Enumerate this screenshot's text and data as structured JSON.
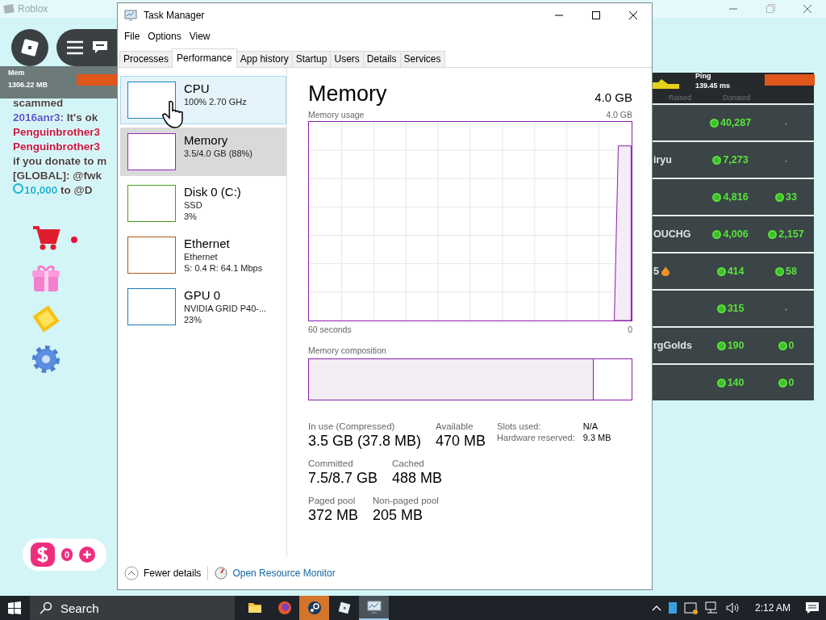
{
  "roblox_window": {
    "title": "Roblox"
  },
  "hud": {
    "mem_label": "Mem",
    "mem_value": "1306.22 MB",
    "ping_label": "Ping",
    "ping_value": "139.45 ms"
  },
  "chat": [
    {
      "kind": "message",
      "parts": [
        {
          "text": "scammed"
        }
      ]
    },
    {
      "kind": "message",
      "parts": [
        {
          "text": "2016anr3:",
          "color": "#5257c9"
        },
        {
          "text": " It's ok"
        }
      ]
    },
    {
      "kind": "message",
      "parts": [
        {
          "text": "Penguinbrother3",
          "color": "#c4163f"
        }
      ]
    },
    {
      "kind": "message",
      "parts": [
        {
          "text": "Penguinbrother3",
          "color": "#c4163f"
        }
      ]
    },
    {
      "kind": "message",
      "parts": [
        {
          "text": "if you donate to m"
        }
      ]
    },
    {
      "kind": "message",
      "parts": [
        {
          "text": "[GLOBAL]: @fwk"
        }
      ]
    },
    {
      "kind": "donation",
      "parts": [
        {
          "text": "10,000",
          "color": "#19b4d6"
        },
        {
          "text": " to @D"
        }
      ]
    }
  ],
  "side_buttons": [
    {
      "kind": "cart",
      "alert": true
    },
    {
      "kind": "gift",
      "alert": false
    },
    {
      "kind": "diamond",
      "alert": false
    },
    {
      "kind": "gear",
      "alert": false
    }
  ],
  "currency": {
    "amount": "0"
  },
  "leaderboard": {
    "columns": [
      "Raised",
      "Donated"
    ],
    "rows": [
      {
        "raised": "40,287",
        "donated": {
          "kind": "none",
          "text": "-"
        }
      },
      {
        "name": "iryu",
        "raised": "7,273",
        "donated": {
          "kind": "none",
          "text": "-"
        }
      },
      {
        "raised": "4,816",
        "donated": {
          "kind": "robux",
          "text": "33"
        }
      },
      {
        "name": "OUCHG",
        "raised": "4,006",
        "donated": {
          "kind": "robux",
          "text": "2,157"
        }
      },
      {
        "name": "5",
        "fire": true,
        "raised": "414",
        "donated": {
          "kind": "robux",
          "text": "58"
        }
      },
      {
        "raised": "315",
        "donated": {
          "kind": "none",
          "text": "-"
        }
      },
      {
        "name": "rgGolds",
        "raised": "190",
        "donated": {
          "kind": "robux",
          "text": "0"
        }
      },
      {
        "raised": "140",
        "donated": {
          "kind": "robux",
          "text": "0"
        }
      }
    ]
  },
  "task_manager": {
    "title": "Task Manager",
    "menu": [
      "File",
      "Options",
      "View"
    ],
    "tabs": [
      {
        "label": "Processes",
        "selected": false
      },
      {
        "label": "Performance",
        "selected": true
      },
      {
        "label": "App history",
        "selected": false
      },
      {
        "label": "Startup",
        "selected": false
      },
      {
        "label": "Users",
        "selected": false
      },
      {
        "label": "Details",
        "selected": false
      },
      {
        "label": "Services",
        "selected": false
      }
    ],
    "sidebar": [
      {
        "title": "CPU",
        "lines": [
          "100%  2.70 GHz"
        ],
        "color": "#1986c0",
        "selected": false,
        "hovered": true
      },
      {
        "title": "Memory",
        "lines": [
          "3.5/4.0 GB (88%)"
        ],
        "color": "#9528b4",
        "selected": true,
        "hovered": false
      },
      {
        "title": "Disk 0 (C:)",
        "lines": [
          "SSD",
          "3%"
        ],
        "color": "#4d9a1e",
        "selected": false,
        "hovered": false
      },
      {
        "title": "Ethernet",
        "lines": [
          "Ethernet",
          "S: 0.4 R: 64.1 Mbps"
        ],
        "color": "#a7591a",
        "selected": false,
        "hovered": false
      },
      {
        "title": "GPU 0",
        "lines": [
          "NVIDIA GRID P40-...",
          "23%"
        ],
        "color": "#1a7fb0",
        "selected": false,
        "hovered": false
      }
    ],
    "detail": {
      "title": "Memory",
      "total": "4.0 GB",
      "graph_label": "Memory usage",
      "graph_max": "4.0 GB",
      "time_label": "60 seconds",
      "time_end": "0",
      "composition_label": "Memory composition",
      "composition": {
        "level": 0.88
      },
      "stats": [
        [
          {
            "label": "In use (Compressed)",
            "value": "3.5 GB (37.8 MB)"
          },
          {
            "label": "Available",
            "value": "470 MB"
          }
        ],
        [
          {
            "label": "Committed",
            "value": "7.5/8.7 GB"
          },
          {
            "label": "Cached",
            "value": "488 MB"
          }
        ],
        [
          {
            "label": "Paged pool",
            "value": "372 MB"
          },
          {
            "label": "Non-paged pool",
            "value": "205 MB"
          }
        ]
      ],
      "side_stats": [
        {
          "label": "Slots used:",
          "value": "N/A"
        },
        {
          "label": "Hardware reserved:",
          "value": "9.3 MB"
        }
      ]
    },
    "footer": {
      "fewer": "Fewer details",
      "monitor": "Open Resource Monitor"
    }
  },
  "taskbar": {
    "search_placeholder": "Search",
    "apps": [
      {
        "kind": "folder",
        "hovered": false,
        "open": false
      },
      {
        "kind": "firefox",
        "hovered": false,
        "open": false
      },
      {
        "kind": "steam",
        "hovered": true,
        "open": false
      },
      {
        "kind": "roblox",
        "hovered": false,
        "open": false
      },
      {
        "kind": "taskmgr",
        "hovered": false,
        "open": true
      }
    ],
    "clock": "2:12 AM"
  }
}
